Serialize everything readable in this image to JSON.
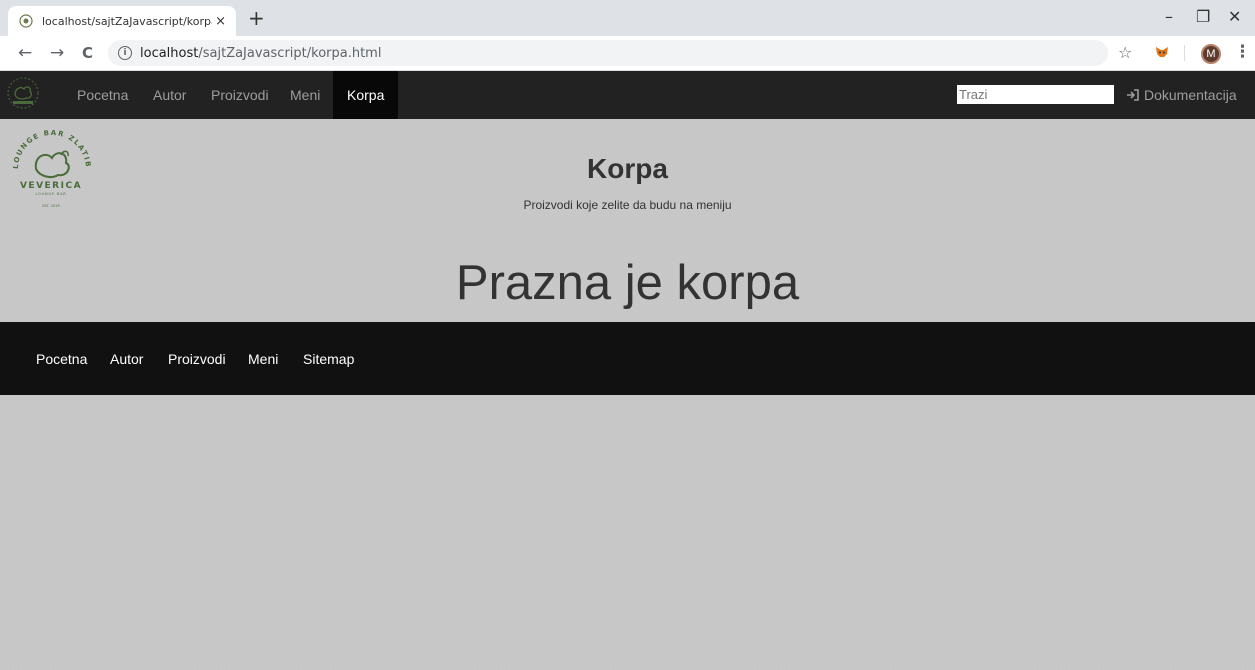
{
  "browser": {
    "tab_title": "localhost/sajtZaJavascript/korpa.h",
    "tab_close": "×",
    "new_tab": "+",
    "window_controls": {
      "minimize": "–",
      "restore": "❐",
      "close": "✕"
    },
    "nav": {
      "back": "←",
      "forward": "→",
      "reload": "C"
    },
    "url_host": "localhost",
    "url_path": "/sajtZaJavascript/korpa.html",
    "bookmark_star": "☆",
    "profile_initial": "M",
    "menu": "⋮",
    "icons": [
      "tab-favicon-icon",
      "info-icon",
      "star-icon",
      "metamask-extension-icon",
      "kebab-menu-icon"
    ]
  },
  "topnav": {
    "links": [
      {
        "label": "Pocetna",
        "active": false
      },
      {
        "label": "Autor",
        "active": false
      },
      {
        "label": "Proizvodi",
        "active": false
      },
      {
        "label": "Meni",
        "active": false
      },
      {
        "label": "Korpa",
        "active": true
      }
    ],
    "search_placeholder": "Trazi",
    "doc_label": "Dokumentacija",
    "doc_icon": "sign-in-icon"
  },
  "logo": {
    "name": "VEVERICA",
    "arc_text": "LOUNGE BAR ZLATIBOR",
    "sub_text": "LOUNGE BAR",
    "est": "EST. 2019",
    "color": "#4a6b3a"
  },
  "header": {
    "title": "Korpa",
    "subtitle": "Proizvodi koje zelite da budu na meniju"
  },
  "cart": {
    "empty_message": "Prazna je korpa"
  },
  "footer": {
    "links": [
      "Pocetna",
      "Autor",
      "Proizvodi",
      "Meni",
      "Sitemap"
    ]
  },
  "colors": {
    "navbar_bg": "#222222",
    "navbar_active_bg": "#080808",
    "footer_bg": "#111111",
    "page_bg": "#c6c6c6",
    "text": "#333333"
  }
}
